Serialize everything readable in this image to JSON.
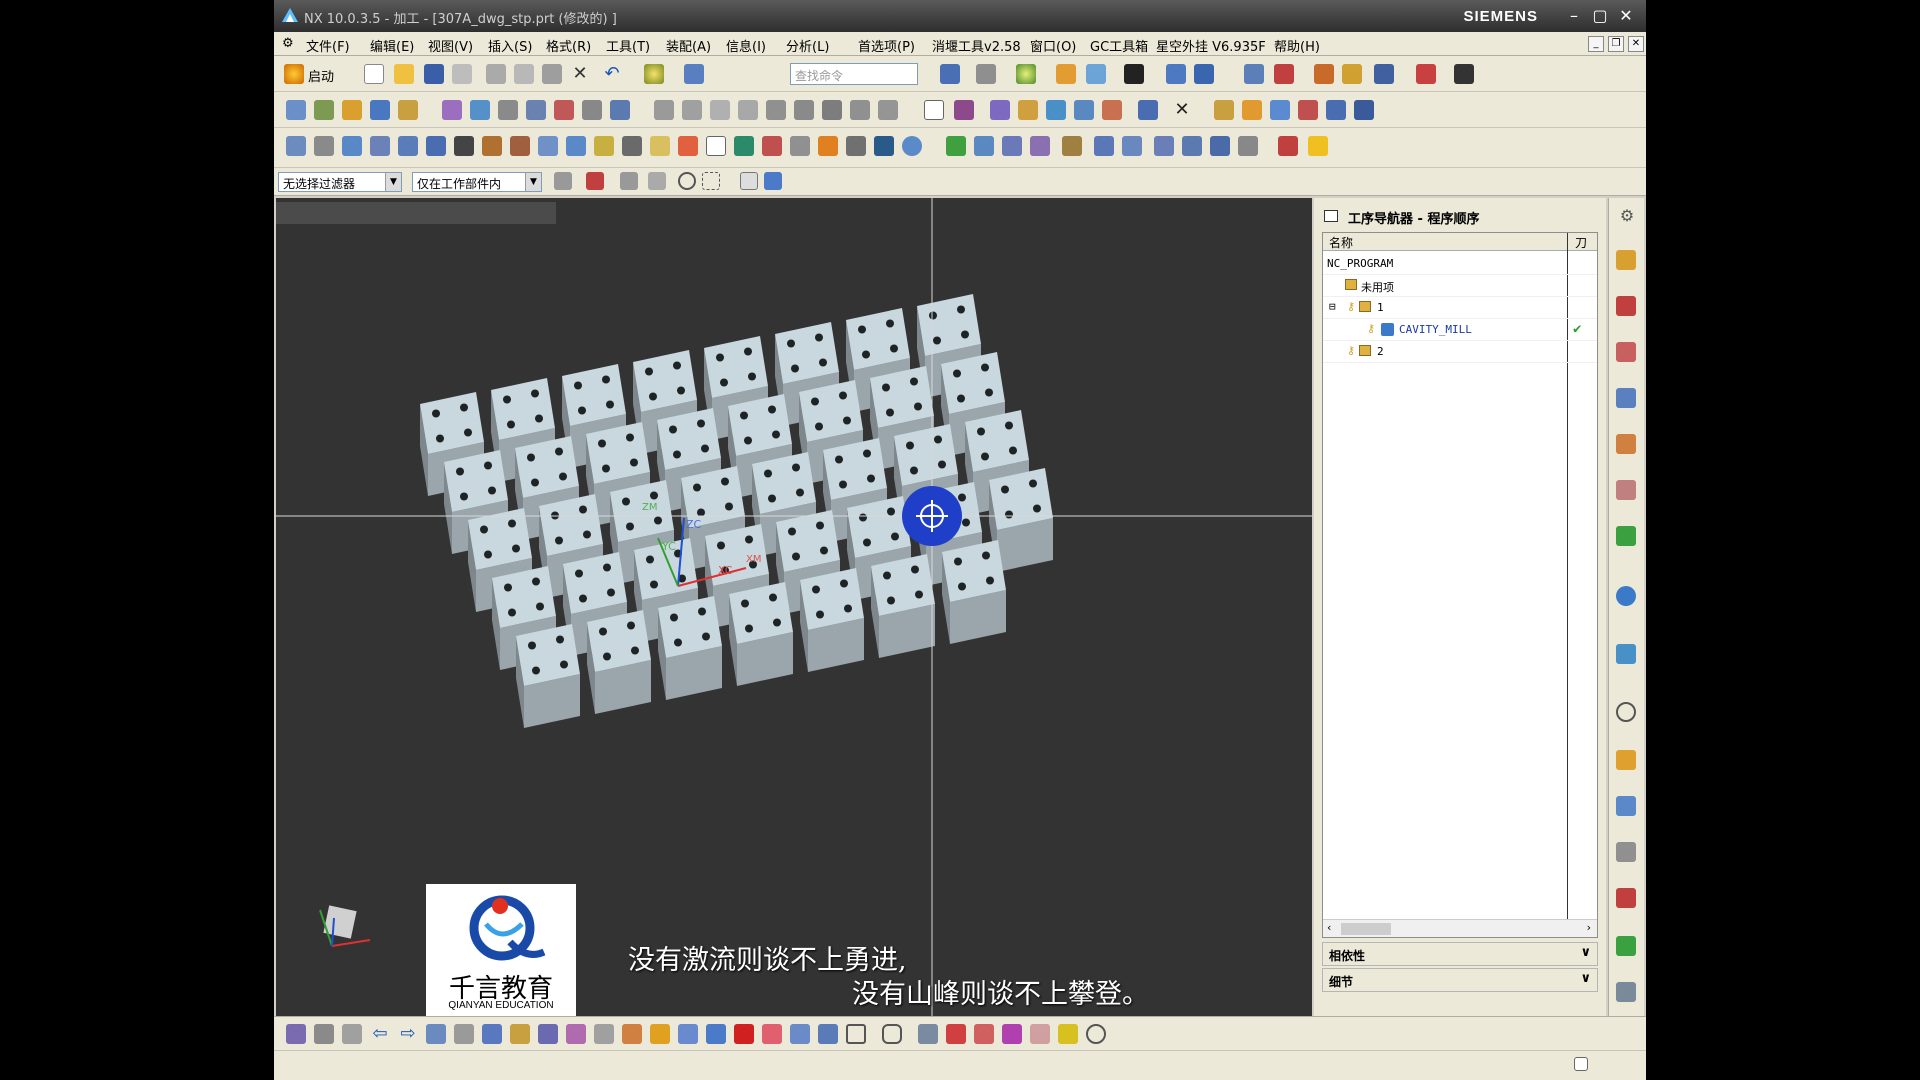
{
  "window": {
    "title": "NX 10.0.3.5 - 加工 - [307A_dwg_stp.prt  (修改的) ]",
    "brand": "SIEMENS"
  },
  "menu": [
    "文件(F)",
    "编辑(E)",
    "视图(V)",
    "插入(S)",
    "格式(R)",
    "工具(T)",
    "装配(A)",
    "信息(I)",
    "分析(L)",
    "首选项(P)",
    "消堰工具v2.58",
    "窗口(O)",
    "GC工具箱",
    "星空外挂 V6.935F",
    "帮助(H)"
  ],
  "toolbar": {
    "start_label": "启动",
    "search_placeholder": "查找命令"
  },
  "filter": {
    "selection_filter": "无选择过滤器",
    "scope": "仅在工作部件内"
  },
  "navigator": {
    "title": "工序导航器 - 程序顺序",
    "col_name": "名称",
    "col_tool": "刀",
    "rows": [
      {
        "label": "NC_PROGRAM"
      },
      {
        "label": "未用项"
      },
      {
        "label": "1"
      },
      {
        "label": "CAVITY_MILL",
        "status": "✔"
      },
      {
        "label": "2"
      }
    ],
    "dependencies": "相依性",
    "details": "细节"
  },
  "viewport": {
    "subtitle_line1": "没有激流则谈不上勇进,",
    "subtitle_line2": "没有山峰则谈不上攀登。",
    "logo_name": "千言教育",
    "logo_en": "QIANYAN EDUCATION",
    "axis_x": "XC",
    "axis_y": "YC",
    "axis_z": "ZC",
    "axis_zm": "ZM",
    "axis_xm": "XM"
  },
  "colors": {
    "viewport_bg": "#333333",
    "cube_top": "#c8d8de",
    "cube_side": "#9aa6ab",
    "snap_circle": "#1f3fc8"
  }
}
